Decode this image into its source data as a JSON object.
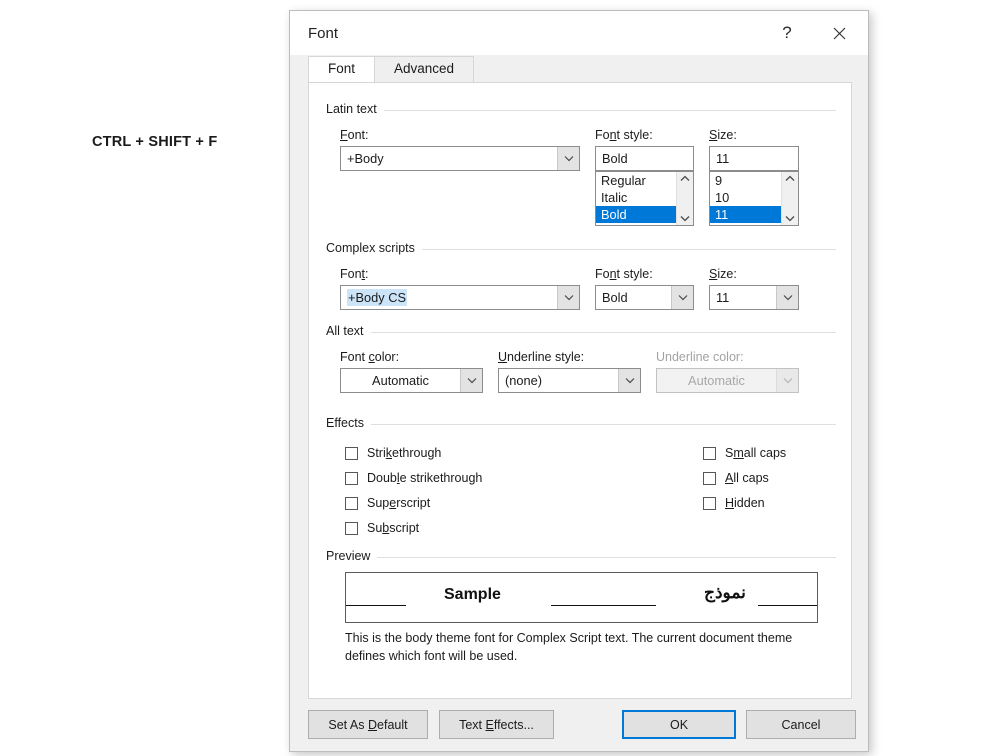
{
  "background": {
    "shortcut_hint": "CTRL + SHIFT + F"
  },
  "dialog": {
    "title": "Font",
    "help_icon": "?",
    "close_icon": "✕",
    "tabs": [
      {
        "label": "Font",
        "mnemonic": "n",
        "active": true
      },
      {
        "label": "Advanced",
        "mnemonic": "v",
        "active": false
      }
    ],
    "groups": {
      "latin_text": {
        "label": "Latin text",
        "font_label": "Font:",
        "font_value": "+Body",
        "font_style_label": "Font style:",
        "font_style_value": "Bold",
        "font_style_options": [
          "Regular",
          "Italic",
          "Bold"
        ],
        "font_style_selected": "Bold",
        "size_label": "Size:",
        "size_value": "11",
        "size_options": [
          "9",
          "10",
          "11"
        ],
        "size_selected": "11"
      },
      "complex_scripts": {
        "label": "Complex scripts",
        "font_label": "Font:",
        "font_value": "+Body CS",
        "font_value_selected": true,
        "font_style_label": "Font style:",
        "font_style_value": "Bold",
        "size_label": "Size:",
        "size_value": "11"
      },
      "all_text": {
        "label": "All text",
        "font_color_label": "Font color:",
        "font_color_value": "Automatic",
        "underline_style_label": "Underline style:",
        "underline_style_value": "(none)",
        "underline_color_label": "Underline color:",
        "underline_color_value": "Automatic",
        "underline_color_disabled": true
      },
      "effects": {
        "label": "Effects",
        "left_column": [
          {
            "label": "Strikethrough",
            "checked": false
          },
          {
            "label": "Double strikethrough",
            "checked": false
          },
          {
            "label": "Superscript",
            "checked": false
          },
          {
            "label": "Subscript",
            "checked": false
          }
        ],
        "right_column": [
          {
            "label": "Small caps",
            "checked": false
          },
          {
            "label": "All caps",
            "checked": false
          },
          {
            "label": "Hidden",
            "checked": false
          }
        ]
      },
      "preview": {
        "label": "Preview",
        "sample_latin": "Sample",
        "sample_complex": "نموذج",
        "note": "This is the body theme font for Complex Script text. The current document theme defines which font will be used."
      }
    },
    "footer": {
      "set_as_default": "Set As Default",
      "text_effects": "Text Effects...",
      "ok": "OK",
      "cancel": "Cancel"
    },
    "colors": {
      "accent": "#0078d7",
      "selection_highlight": "#cce4f7",
      "dialog_bg": "#f0f0f0",
      "panel_bg": "#ffffff"
    }
  }
}
